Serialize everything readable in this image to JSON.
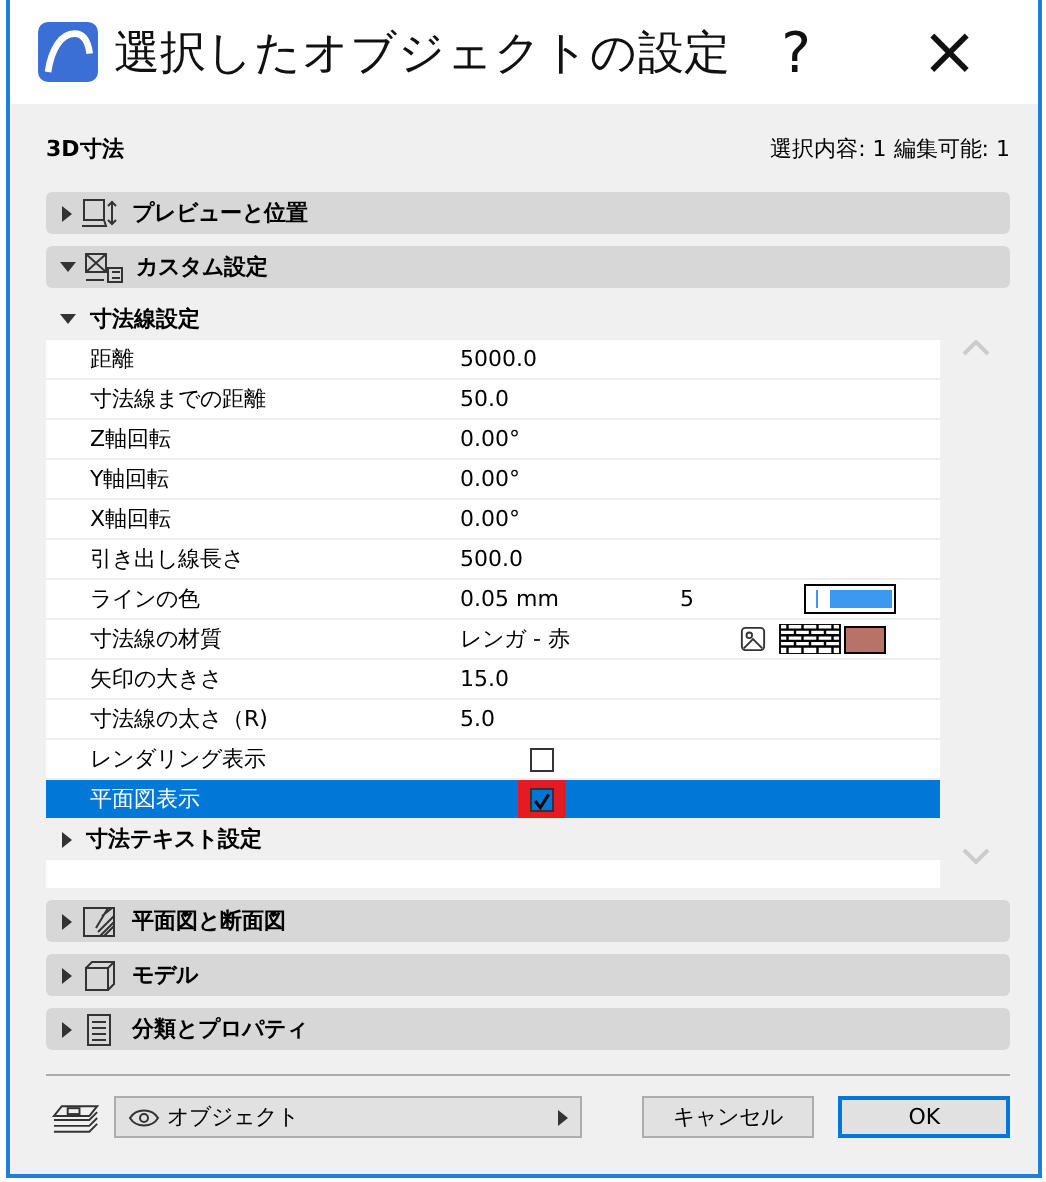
{
  "window": {
    "title": "選択したオブジェクトの設定",
    "help": "?",
    "close": "×"
  },
  "header": {
    "element_type": "3D寸法",
    "selection_info": "選択内容: 1 編集可能: 1"
  },
  "panels_top": [
    {
      "kind": "preview",
      "label": "プレビューと位置",
      "expanded": false
    },
    {
      "kind": "custom",
      "label": "カスタム設定",
      "expanded": true
    }
  ],
  "groups": [
    {
      "label": "寸法線設定",
      "expanded": true,
      "rows": [
        {
          "kind": "value",
          "name": "距離",
          "value": "5000.0",
          "selected": false
        },
        {
          "kind": "value",
          "name": "寸法線までの距離",
          "value": "50.0",
          "selected": false
        },
        {
          "kind": "value",
          "name": "Z軸回転",
          "value": "0.00°",
          "selected": false
        },
        {
          "kind": "value",
          "name": "Y軸回転",
          "value": "0.00°",
          "selected": false
        },
        {
          "kind": "value",
          "name": "X軸回転",
          "value": "0.00°",
          "selected": false
        },
        {
          "kind": "value",
          "name": "引き出し線長さ",
          "value": "500.0",
          "selected": false
        },
        {
          "kind": "pen",
          "name": "ラインの色",
          "value": "0.05 mm",
          "pen": "5",
          "color": "#3d98f0",
          "selected": false
        },
        {
          "kind": "material",
          "name": "寸法線の材質",
          "value": "レンガ - 赤",
          "color": "#b87368",
          "selected": false
        },
        {
          "kind": "value",
          "name": "矢印の大きさ",
          "value": "15.0",
          "selected": false
        },
        {
          "kind": "value",
          "name": "寸法線の太さ（R)",
          "value": "5.0",
          "selected": false
        },
        {
          "kind": "checkbox",
          "name": "レンダリング表示",
          "checked": false,
          "highlighted": false,
          "selected": false
        },
        {
          "kind": "checkbox",
          "name": "平面図表示",
          "checked": true,
          "highlighted": true,
          "selected": true
        }
      ]
    },
    {
      "label": "寸法テキスト設定",
      "expanded": false
    }
  ],
  "panels_bottom": [
    {
      "kind": "plan",
      "label": "平面図と断面図",
      "expanded": false
    },
    {
      "kind": "model",
      "label": "モデル",
      "expanded": false
    },
    {
      "kind": "properties",
      "label": "分類とプロパティ",
      "expanded": false
    }
  ],
  "footer": {
    "layer": "オブジェクト",
    "cancel": "キャンセル",
    "ok": "OK"
  }
}
